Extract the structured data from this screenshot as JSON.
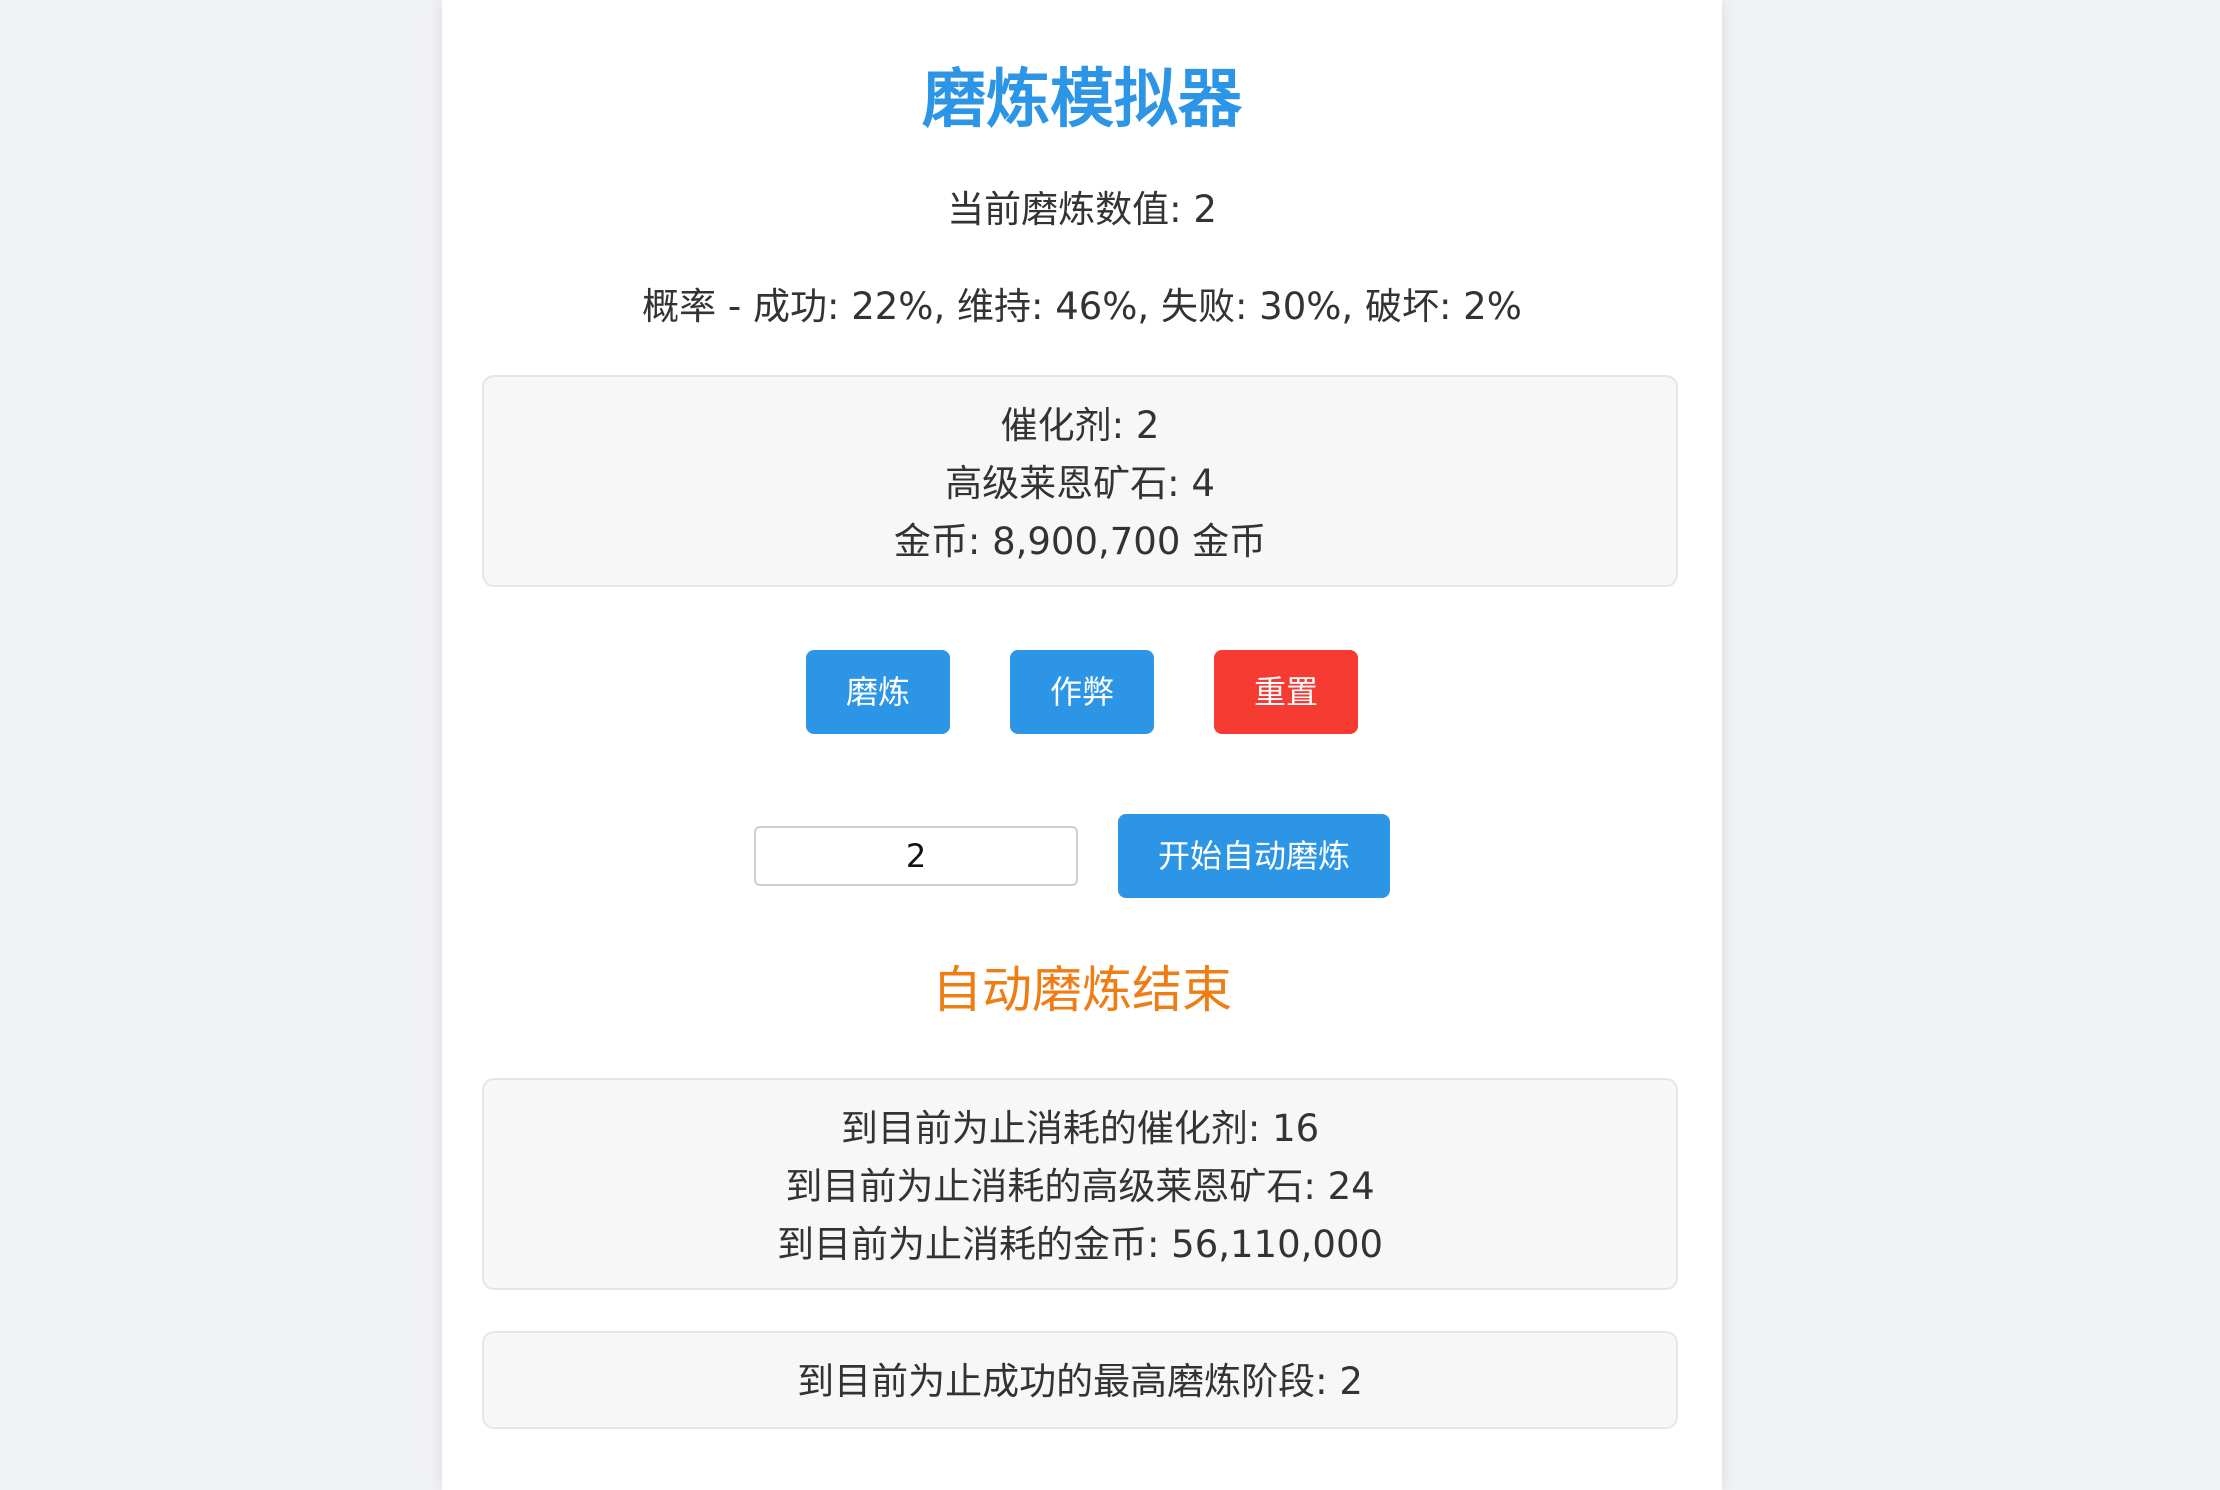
{
  "app": {
    "title": "磨炼模拟器"
  },
  "state": {
    "current_value_text": "当前磨炼数值: 2",
    "probability_text": "概率 - 成功: 22%, 维持: 46%, 失败: 30%, 破坏: 2%"
  },
  "inventory": {
    "catalyst": "催化剂: 2",
    "ore": "高级莱恩矿石: 4",
    "gold": "金币: 8,900,700 金币"
  },
  "actions": {
    "refine_label": "磨炼",
    "cheat_label": "作弊",
    "reset_label": "重置",
    "auto_label": "开始自动磨炼",
    "auto_input_value": "2"
  },
  "colors": {
    "primary": "#2d95e6",
    "danger": "#f53b32",
    "status": "#f07d14"
  },
  "status": {
    "text": "自动磨炼结束"
  },
  "consumed": {
    "catalyst": "到目前为止消耗的催化剂: 16",
    "ore": "到目前为止消耗的高级莱恩矿石: 24",
    "gold": "到目前为止消耗的金币: 56,110,000"
  },
  "best": {
    "text": "到目前为止成功的最高磨炼阶段: 2"
  }
}
